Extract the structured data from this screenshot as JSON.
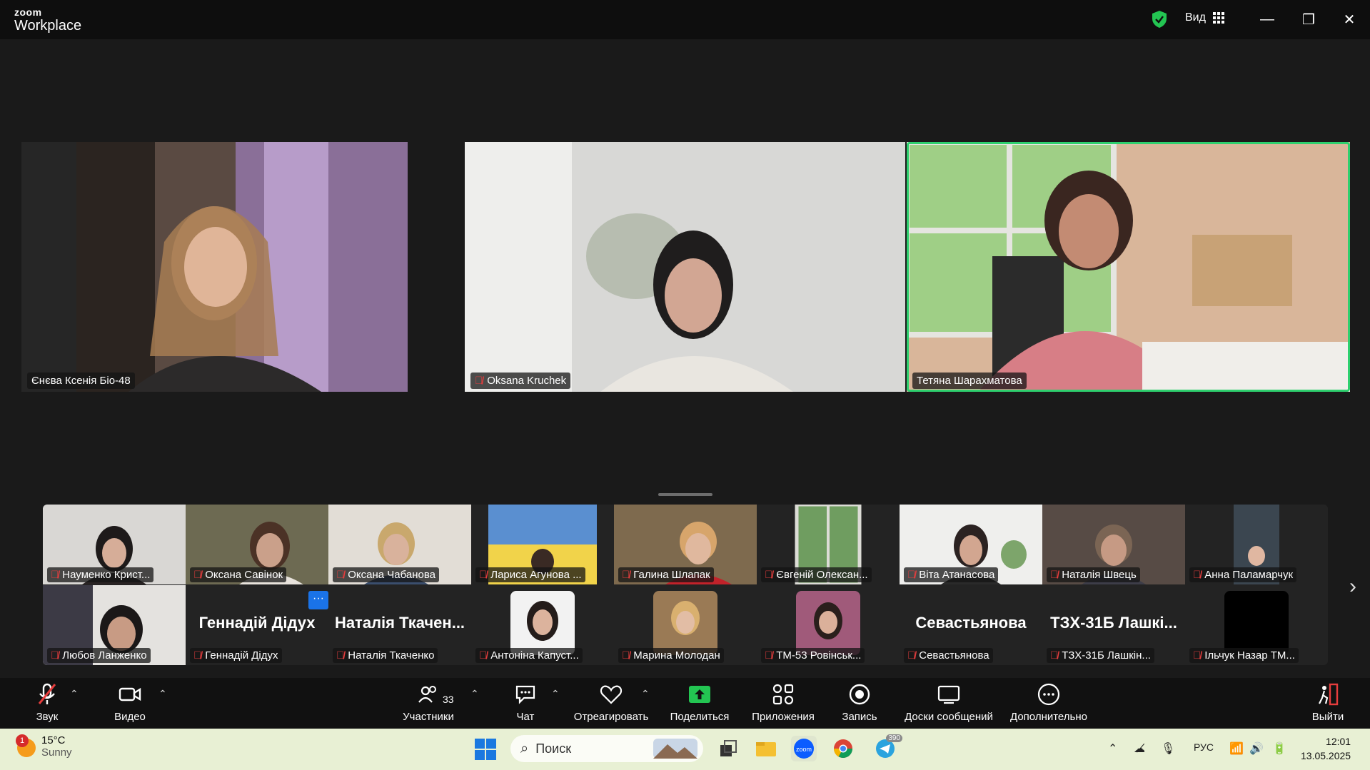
{
  "titlebar": {
    "logo_top": "zoom",
    "logo_bottom": "Workplace",
    "view_label": "Вид"
  },
  "main_videos": [
    {
      "name": "Єнєва Ксенія Біо-48",
      "muted": false
    },
    {
      "name": "Oksana Kruchek",
      "muted": true
    },
    {
      "name": "Тетяна Шарахматова",
      "muted": false
    }
  ],
  "strip_row1": [
    {
      "name": "Науменко Крист..."
    },
    {
      "name": "Оксана Савінок"
    },
    {
      "name": "Оксана Чабанова"
    },
    {
      "name": "Лариса Агунова ..."
    },
    {
      "name": "Галина Шлапак"
    },
    {
      "name": "Євгеній Олексан..."
    },
    {
      "name": "Віта Атанасова"
    },
    {
      "name": "Наталія Швець"
    },
    {
      "name": "Анна Паламарчук"
    }
  ],
  "strip_row2": [
    {
      "name": "Любов Ланженко",
      "big": ""
    },
    {
      "name": "Геннадій Дідух",
      "big": "Геннадій Дідух"
    },
    {
      "name": "Наталія Ткаченко",
      "big": "Наталія Ткачен..."
    },
    {
      "name": "Антоніна Капуст...",
      "big": ""
    },
    {
      "name": "Марина Молодан",
      "big": ""
    },
    {
      "name": "ТМ-53 Ровінськ...",
      "big": ""
    },
    {
      "name": "Севастьянова",
      "big": "Севастьянова"
    },
    {
      "name": "ТЗХ-31Б Лашкін...",
      "big": "ТЗХ-31Б Лашкі..."
    },
    {
      "name": "Ільчук Назар ТМ...",
      "big": ""
    }
  ],
  "toolbar": {
    "audio": "Звук",
    "video": "Видео",
    "participants": "Участники",
    "participants_count": "33",
    "chat": "Чат",
    "react": "Отреагировать",
    "share": "Поделиться",
    "apps": "Приложения",
    "record": "Запись",
    "whiteboards": "Доски сообщений",
    "more": "Дополнительно",
    "leave": "Выйти"
  },
  "taskbar": {
    "weather_temp": "15°C",
    "weather_desc": "Sunny",
    "weather_badge": "1",
    "search_placeholder": "Поиск",
    "telegram_badge": "390",
    "language": "РУС",
    "time": "12:01",
    "date": "13.05.2025"
  },
  "colors": {
    "active_speaker": "#2ed06e",
    "share_green": "#23c552",
    "muted_red": "#e63d3d"
  }
}
